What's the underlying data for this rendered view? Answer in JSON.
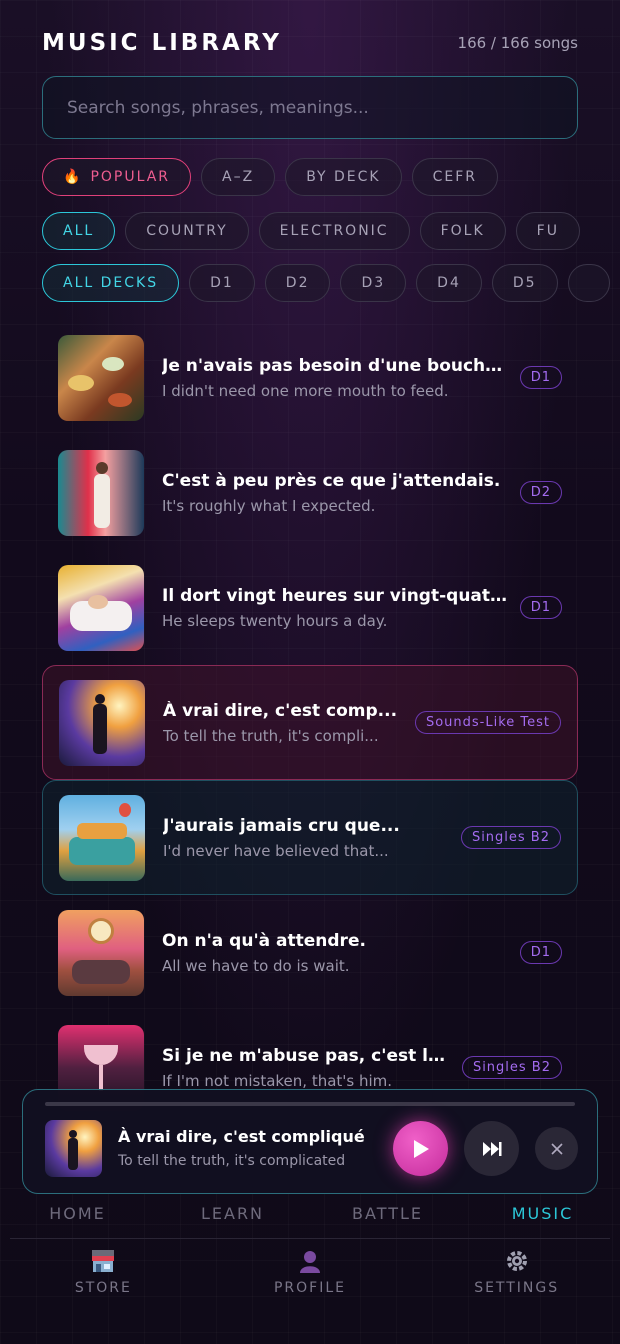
{
  "header": {
    "title": "MUSIC LIBRARY",
    "count": "166 / 166 songs"
  },
  "search": {
    "placeholder": "Search songs, phrases, meanings..."
  },
  "sort_chips": [
    {
      "label": "POPULAR",
      "icon": "flame-icon",
      "state": "hot"
    },
    {
      "label": "A–Z",
      "state": ""
    },
    {
      "label": "BY DECK",
      "state": ""
    },
    {
      "label": "CEFR",
      "state": ""
    }
  ],
  "genre_chips": [
    {
      "label": "ALL",
      "state": "sel"
    },
    {
      "label": "COUNTRY",
      "state": ""
    },
    {
      "label": "ELECTRONIC",
      "state": ""
    },
    {
      "label": "FOLK",
      "state": ""
    },
    {
      "label": "FU",
      "state": ""
    }
  ],
  "deck_chips": [
    {
      "label": "ALL DECKS",
      "state": "sel"
    },
    {
      "label": "D1",
      "state": ""
    },
    {
      "label": "D2",
      "state": ""
    },
    {
      "label": "D3",
      "state": ""
    },
    {
      "label": "D4",
      "state": ""
    },
    {
      "label": "D5",
      "state": ""
    },
    {
      "label": "",
      "state": ""
    }
  ],
  "songs": [
    {
      "phrase": "Je n'avais pas besoin d'une bouche ...",
      "meaning": "I didn't need one more mouth to feed.",
      "badge": "D1",
      "state": "",
      "art": "food"
    },
    {
      "phrase": "C'est à peu près ce que j'attendais.",
      "meaning": "It's roughly what I expected.",
      "badge": "D2",
      "state": "",
      "art": "woman"
    },
    {
      "phrase": "Il dort vingt heures sur vingt-quatre.",
      "meaning": "He sleeps twenty hours a day.",
      "badge": "D1",
      "state": "",
      "art": "bed"
    },
    {
      "phrase": "À vrai dire, c'est comp...",
      "meaning": "To tell the truth, it's compli...",
      "badge": "Sounds-Like Test",
      "state": "active",
      "art": "walker"
    },
    {
      "phrase": "J'aurais jamais cru que...",
      "meaning": "I'd never have believed that...",
      "badge": "Singles B2",
      "state": "next",
      "art": "van"
    },
    {
      "phrase": "On n'a qu'à attendre.",
      "meaning": "All we have to do is wait.",
      "badge": "D1",
      "state": "",
      "art": "clock"
    },
    {
      "phrase": "Si je ne m'abuse pas, c'est lui.",
      "meaning": "If I'm not mistaken, that's him.",
      "badge": "Singles B2",
      "state": "",
      "art": "bar"
    }
  ],
  "player": {
    "title": "À vrai dire, c'est compliqué",
    "subtitle": "To tell the truth, it's complicated",
    "progress": 0
  },
  "nav_primary": [
    {
      "label": "HOME",
      "active": false
    },
    {
      "label": "LEARN",
      "active": false
    },
    {
      "label": "BATTLE",
      "active": false
    },
    {
      "label": "MUSIC",
      "active": true
    }
  ],
  "nav_secondary": [
    {
      "label": "STORE",
      "icon": "store-icon"
    },
    {
      "label": "PROFILE",
      "icon": "profile-icon"
    },
    {
      "label": "SETTINGS",
      "icon": "gear-icon"
    }
  ],
  "colors": {
    "accent_cyan": "#2cc7d8",
    "accent_pink": "#e0407a",
    "badge_purple": "#a46cf0"
  }
}
